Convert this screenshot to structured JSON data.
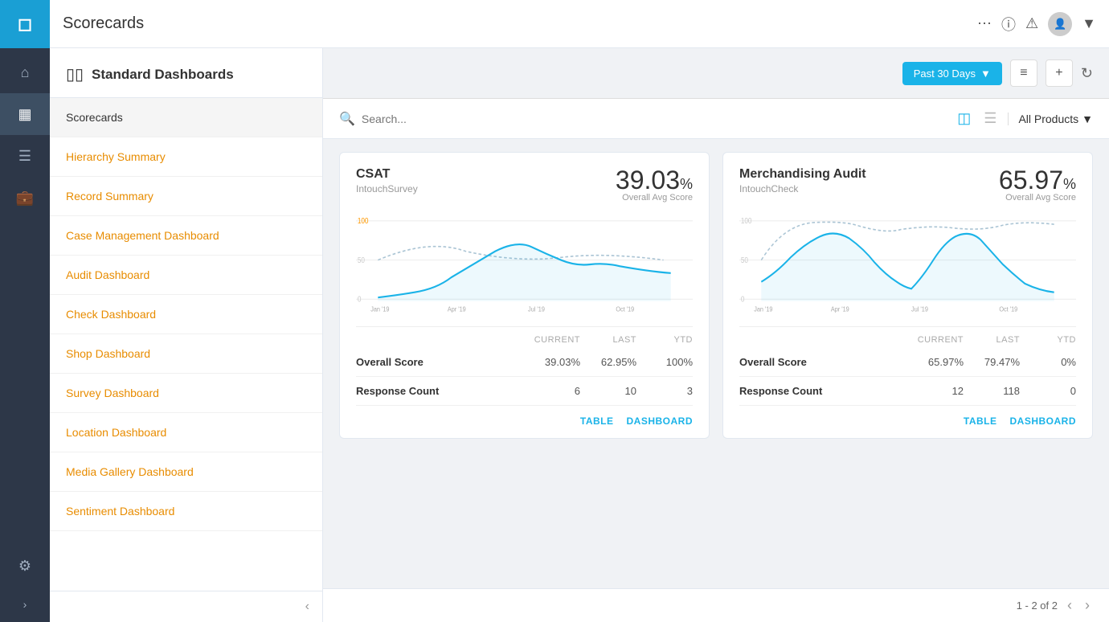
{
  "app": {
    "title": "Scorecards"
  },
  "iconBar": {
    "icons": [
      "home",
      "chart",
      "list",
      "briefcase",
      "gear"
    ],
    "expand": ">"
  },
  "sidebar": {
    "header": "Standard Dashboards",
    "items": [
      {
        "label": "Scorecards",
        "active": true
      },
      {
        "label": "Hierarchy Summary",
        "active": false
      },
      {
        "label": "Record Summary",
        "active": false
      },
      {
        "label": "Case Management Dashboard",
        "active": false
      },
      {
        "label": "Audit Dashboard",
        "active": false
      },
      {
        "label": "Check Dashboard",
        "active": false
      },
      {
        "label": "Shop Dashboard",
        "active": false
      },
      {
        "label": "Survey Dashboard",
        "active": false
      },
      {
        "label": "Location Dashboard",
        "active": false
      },
      {
        "label": "Media Gallery Dashboard",
        "active": false
      },
      {
        "label": "Sentiment Dashboard",
        "active": false
      }
    ]
  },
  "toolbar": {
    "period_label": "Past 30 Days",
    "filter_icon": "≡",
    "add_icon": "+",
    "refresh_icon": "↻"
  },
  "search": {
    "placeholder": "Search...",
    "products_label": "All Products"
  },
  "cards": [
    {
      "title": "CSAT",
      "subtitle": "IntouchSurvey",
      "score": "39.03",
      "score_pct": "%",
      "score_label": "Overall Avg Score",
      "stats_headers": [
        "",
        "CURRENT",
        "LAST",
        "YTD"
      ],
      "stats": [
        {
          "label": "Overall Score",
          "current": "39.03%",
          "last": "62.95%",
          "ytd": "100%"
        },
        {
          "label": "Response Count",
          "current": "6",
          "last": "10",
          "ytd": "3"
        }
      ],
      "chart_x_labels": [
        "Jan '19",
        "Apr '19",
        "Jul '19",
        "Oct '19"
      ],
      "action_table": "TABLE",
      "action_dashboard": "DASHBOARD"
    },
    {
      "title": "Merchandising Audit",
      "subtitle": "IntouchCheck",
      "score": "65.97",
      "score_pct": "%",
      "score_label": "Overall Avg Score",
      "stats_headers": [
        "",
        "CURRENT",
        "LAST",
        "YTD"
      ],
      "stats": [
        {
          "label": "Overall Score",
          "current": "65.97%",
          "last": "79.47%",
          "ytd": "0%"
        },
        {
          "label": "Response Count",
          "current": "12",
          "last": "118",
          "ytd": "0"
        }
      ],
      "chart_x_labels": [
        "Jan '19",
        "Apr '19",
        "Jul '19",
        "Oct '19"
      ],
      "action_table": "TABLE",
      "action_dashboard": "DASHBOARD"
    }
  ],
  "pagination": {
    "info": "1 - 2 of 2"
  }
}
